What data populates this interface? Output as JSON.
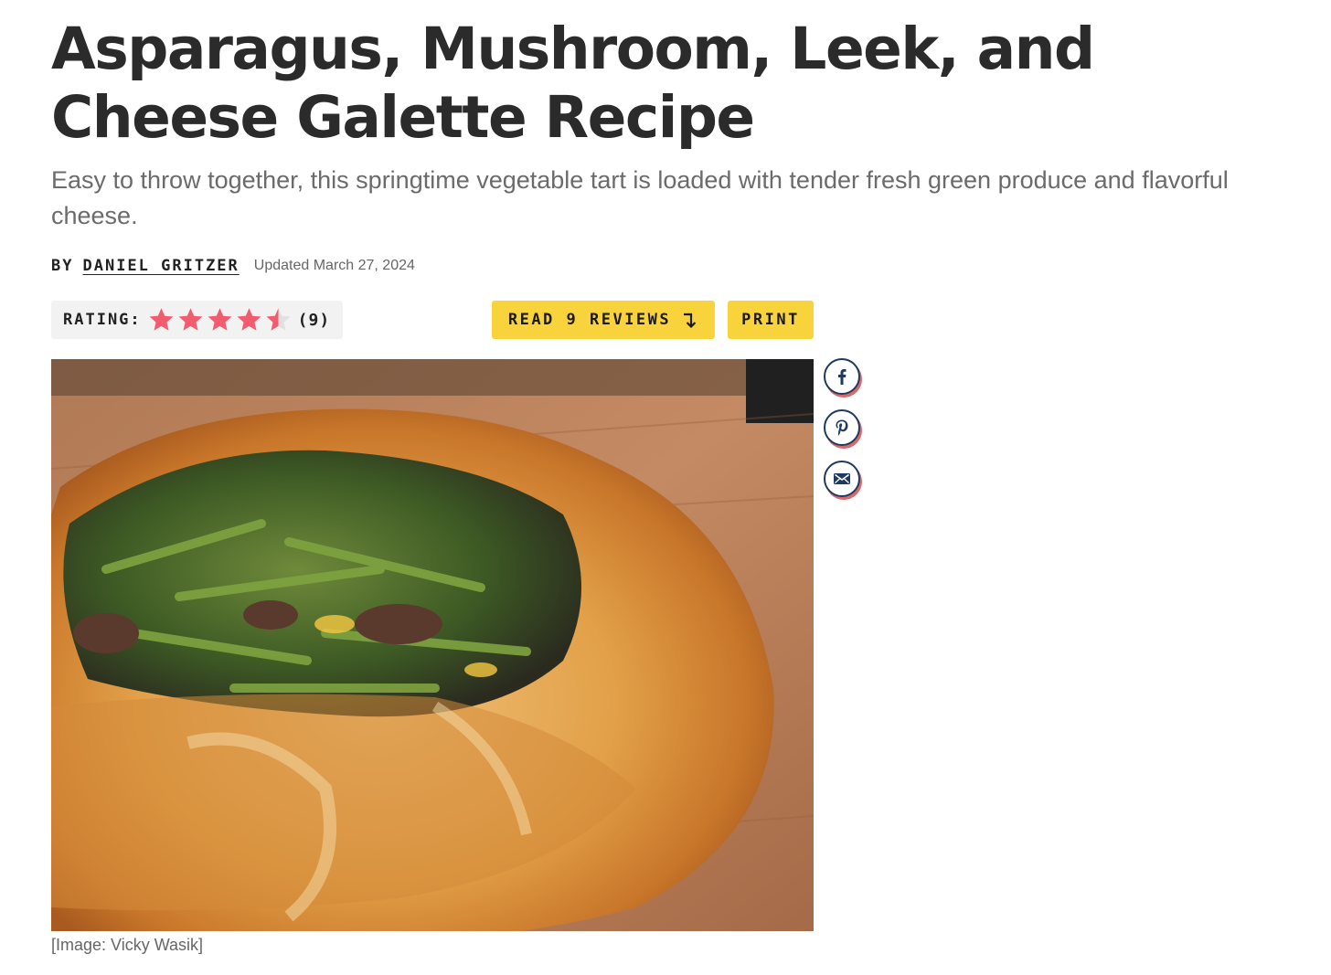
{
  "article": {
    "title": "Asparagus, Mushroom, Leek, and Cheese Galette Recipe",
    "subtitle": "Easy to throw together, this springtime vegetable tart is loaded with tender fresh green produce and flavorful cheese.",
    "byline": {
      "by_label": "BY",
      "author": "DANIEL GRITZER",
      "updated": "Updated March 27, 2024"
    }
  },
  "rating": {
    "label": "RATING:",
    "stars_value": 4.5,
    "stars_max": 5,
    "count": "(9)",
    "star_color": "#f25c6e",
    "star_empty_color": "#e0e0e0"
  },
  "actions": {
    "reviews_label": "READ 9 REVIEWS",
    "reviews_icon": "arrow-down-turn-icon",
    "print_label": "PRINT",
    "button_color": "#f9d33b"
  },
  "image": {
    "caption": "[Image: Vicky Wasik]"
  },
  "share": [
    {
      "name": "facebook-share-button",
      "icon": "facebook-icon"
    },
    {
      "name": "pinterest-share-button",
      "icon": "pinterest-icon"
    },
    {
      "name": "email-share-button",
      "icon": "email-icon"
    }
  ],
  "colors": {
    "title": "#2b2b2b",
    "subtitle": "#6b6b6b",
    "share_ring": "#1e3a5f",
    "share_shadow": "#d96a6a"
  }
}
